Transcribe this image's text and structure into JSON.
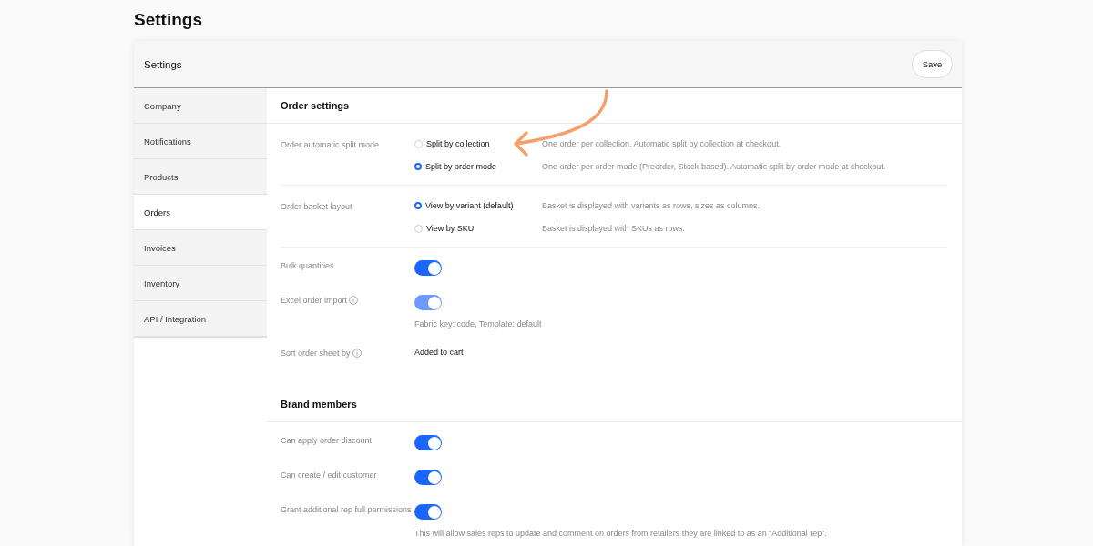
{
  "page_title": "Settings",
  "panel": {
    "title": "Settings",
    "save_button": "Save"
  },
  "sidebar": {
    "items": [
      {
        "label": "Company",
        "selected": false
      },
      {
        "label": "Notifications",
        "selected": false
      },
      {
        "label": "Products",
        "selected": false
      },
      {
        "label": "Orders",
        "selected": true
      },
      {
        "label": "Invoices",
        "selected": false
      },
      {
        "label": "Inventory",
        "selected": false
      },
      {
        "label": "API / Integration",
        "selected": false
      }
    ]
  },
  "sections": [
    {
      "title": "Order settings",
      "rows": [
        {
          "kind": "radio",
          "label": "Order automatic split mode",
          "options": [
            {
              "label": "Split by collection",
              "selected": false,
              "description": "One order per collection. Automatic split by collection at checkout."
            },
            {
              "label": "Split by order mode",
              "selected": true,
              "description": "One order per order mode (Preorder, Stock-based). Automatic split by order mode at checkout."
            }
          ]
        },
        {
          "kind": "radio",
          "label": "Order basket layout",
          "options": [
            {
              "label": "View by variant (default)",
              "selected": true,
              "description": "Basket is displayed with variants as rows, sizes as columns."
            },
            {
              "label": "View by SKU",
              "selected": false,
              "description": "Basket is displayed with SKUs as rows."
            }
          ]
        },
        {
          "kind": "toggle",
          "label": "Bulk quantities",
          "info": false,
          "on": true,
          "disabled": false
        },
        {
          "kind": "toggle",
          "label": "Excel order import",
          "info": true,
          "on": true,
          "disabled": true,
          "note": "Fabric key: code, Template: default"
        },
        {
          "kind": "value",
          "label": "Sort order sheet by",
          "info": true,
          "value": "Added to cart"
        }
      ]
    },
    {
      "title": "Brand members",
      "rows": [
        {
          "kind": "toggle",
          "label": "Can apply order discount",
          "info": false,
          "on": true,
          "disabled": false
        },
        {
          "kind": "toggle",
          "label": "Can create / edit customer",
          "info": false,
          "on": true,
          "disabled": false
        },
        {
          "kind": "toggle",
          "label": "Grant additional rep full permissions",
          "info": false,
          "on": true,
          "disabled": false,
          "note": "This will allow sales reps to update and comment on orders from retailers they are linked to as an “Additional rep”."
        }
      ]
    }
  ]
}
